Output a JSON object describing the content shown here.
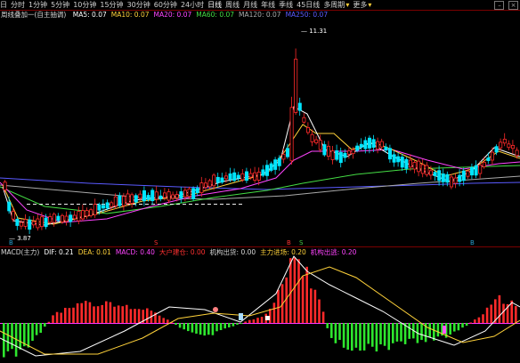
{
  "toolbar": {
    "items": [
      {
        "label": "日"
      },
      {
        "label": "分时"
      },
      {
        "label": "1分钟"
      },
      {
        "label": "5分钟"
      },
      {
        "label": "10分钟"
      },
      {
        "label": "15分钟"
      },
      {
        "label": "30分钟"
      },
      {
        "label": "60分钟"
      },
      {
        "label": "24小时"
      },
      {
        "label": "日线",
        "active": true
      },
      {
        "label": "周线"
      },
      {
        "label": "月线"
      },
      {
        "label": "年线"
      },
      {
        "label": "季线"
      },
      {
        "label": "45日线"
      },
      {
        "label": "多周期",
        "dropdown": true
      },
      {
        "label": "更多",
        "dropdown": true
      }
    ]
  },
  "ma_legend": {
    "title": {
      "text": "周线叠加一(自主抽调)",
      "color": "#d8d8d8"
    },
    "items": [
      {
        "text": "MA5: 0.07",
        "color": "#ffffff"
      },
      {
        "text": "MA10: 0.07",
        "color": "#ffd23a"
      },
      {
        "text": "MA20: 0.07",
        "color": "#ff44ff"
      },
      {
        "text": "MA60: 0.07",
        "color": "#44dd44"
      },
      {
        "text": "MA120: 0.07",
        "color": "#aaaaaa"
      },
      {
        "text": "MA250: 0.07",
        "color": "#5a5aff"
      }
    ]
  },
  "price_labels": {
    "high": "11.31",
    "low": "3.87"
  },
  "markers": [
    {
      "label": "B",
      "color": "#2aa0d0"
    },
    {
      "label": "S",
      "color": "#ff3030"
    },
    {
      "label": "B",
      "color": "#ff3030"
    },
    {
      "label": "S",
      "color": "#44cc44"
    },
    {
      "label": "B",
      "color": "#2aa0d0"
    }
  ],
  "macd_legend": {
    "items": [
      {
        "text": "MACD(主力)",
        "color": "#d8d8d8"
      },
      {
        "text": "DIF: 0.21",
        "color": "#ffffff"
      },
      {
        "text": "DEA: 0.01",
        "color": "#ffd23a"
      },
      {
        "text": "MACD: 0.40",
        "color": "#ff44ff"
      },
      {
        "text": "大户建仓: 0.00",
        "color": "#ff3030"
      },
      {
        "text": "机构出货: 0.00",
        "color": "#d8d8d8"
      },
      {
        "text": "主力进场: 0.20",
        "color": "#ffd23a"
      },
      {
        "text": "机构出逃: 0.20",
        "color": "#ff44ff"
      }
    ]
  },
  "colors": {
    "up": "#ff2a2a",
    "down": "#00e5ff",
    "macd_pos": "#ff2a2a",
    "macd_neg": "#2ee62e",
    "zero_line": "#ff33ff",
    "ma5": "#ffffff",
    "ma10": "#ffd23a",
    "ma20": "#ff44ff",
    "ma60": "#44dd44",
    "ma120": "#aaaaaa",
    "ma250": "#5a5aff"
  }
}
